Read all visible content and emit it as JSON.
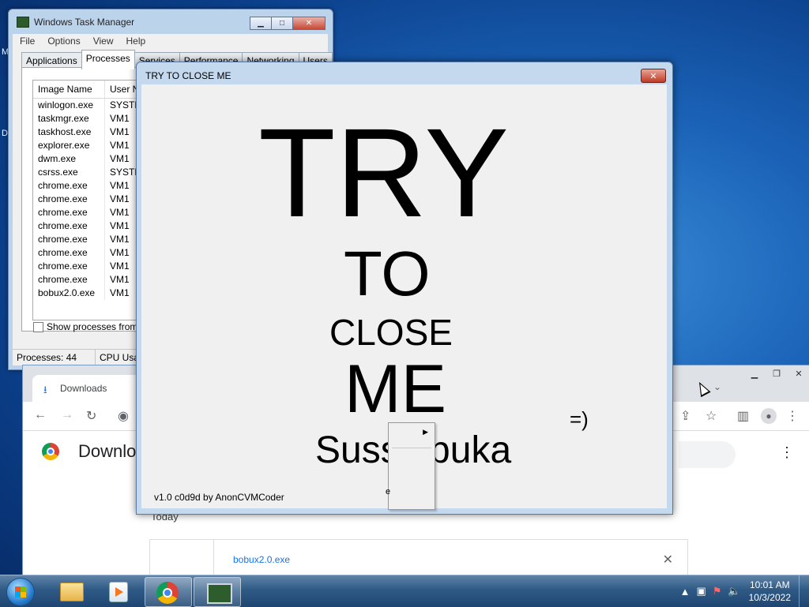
{
  "desktop": {
    "letters": [
      "M",
      "D"
    ]
  },
  "task_manager": {
    "title": "Windows Task Manager",
    "menu": [
      "File",
      "Options",
      "View",
      "Help"
    ],
    "tabs": [
      "Applications",
      "Processes",
      "Services",
      "Performance",
      "Networking",
      "Users"
    ],
    "columns": [
      "Image Name",
      "User Na"
    ],
    "rows": [
      {
        "name": "winlogon.exe",
        "user": "SYSTEM"
      },
      {
        "name": "taskmgr.exe",
        "user": "VM1"
      },
      {
        "name": "taskhost.exe",
        "user": "VM1"
      },
      {
        "name": "explorer.exe",
        "user": "VM1"
      },
      {
        "name": "dwm.exe",
        "user": "VM1"
      },
      {
        "name": "csrss.exe",
        "user": "SYSTEM"
      },
      {
        "name": "chrome.exe",
        "user": "VM1"
      },
      {
        "name": "chrome.exe",
        "user": "VM1"
      },
      {
        "name": "chrome.exe",
        "user": "VM1"
      },
      {
        "name": "chrome.exe",
        "user": "VM1"
      },
      {
        "name": "chrome.exe",
        "user": "VM1"
      },
      {
        "name": "chrome.exe",
        "user": "VM1"
      },
      {
        "name": "chrome.exe",
        "user": "VM1"
      },
      {
        "name": "chrome.exe",
        "user": "VM1"
      },
      {
        "name": "bobux2.0.exe",
        "user": "VM1"
      }
    ],
    "show_all_label": "Show processes from all",
    "status_processes": "Processes: 44",
    "status_cpu": "CPU Usa"
  },
  "prank": {
    "title": "TRY TO CLOSE ME",
    "line1": "TRY",
    "line2": "TO",
    "line3": "CLOSE",
    "line4": "ME",
    "smile": "=)",
    "line5": "Susss  buka",
    "version": "v1.0 c0d9d by AnonCVMCoder",
    "context_fragment": "e"
  },
  "chrome": {
    "tab_label": "Downloads",
    "page_title": "Downlo",
    "section_today": "Today",
    "download_file": "bobux2.0.exe"
  },
  "taskbar": {
    "clock_time": "10:01 AM",
    "clock_date": "10/3/2022"
  }
}
